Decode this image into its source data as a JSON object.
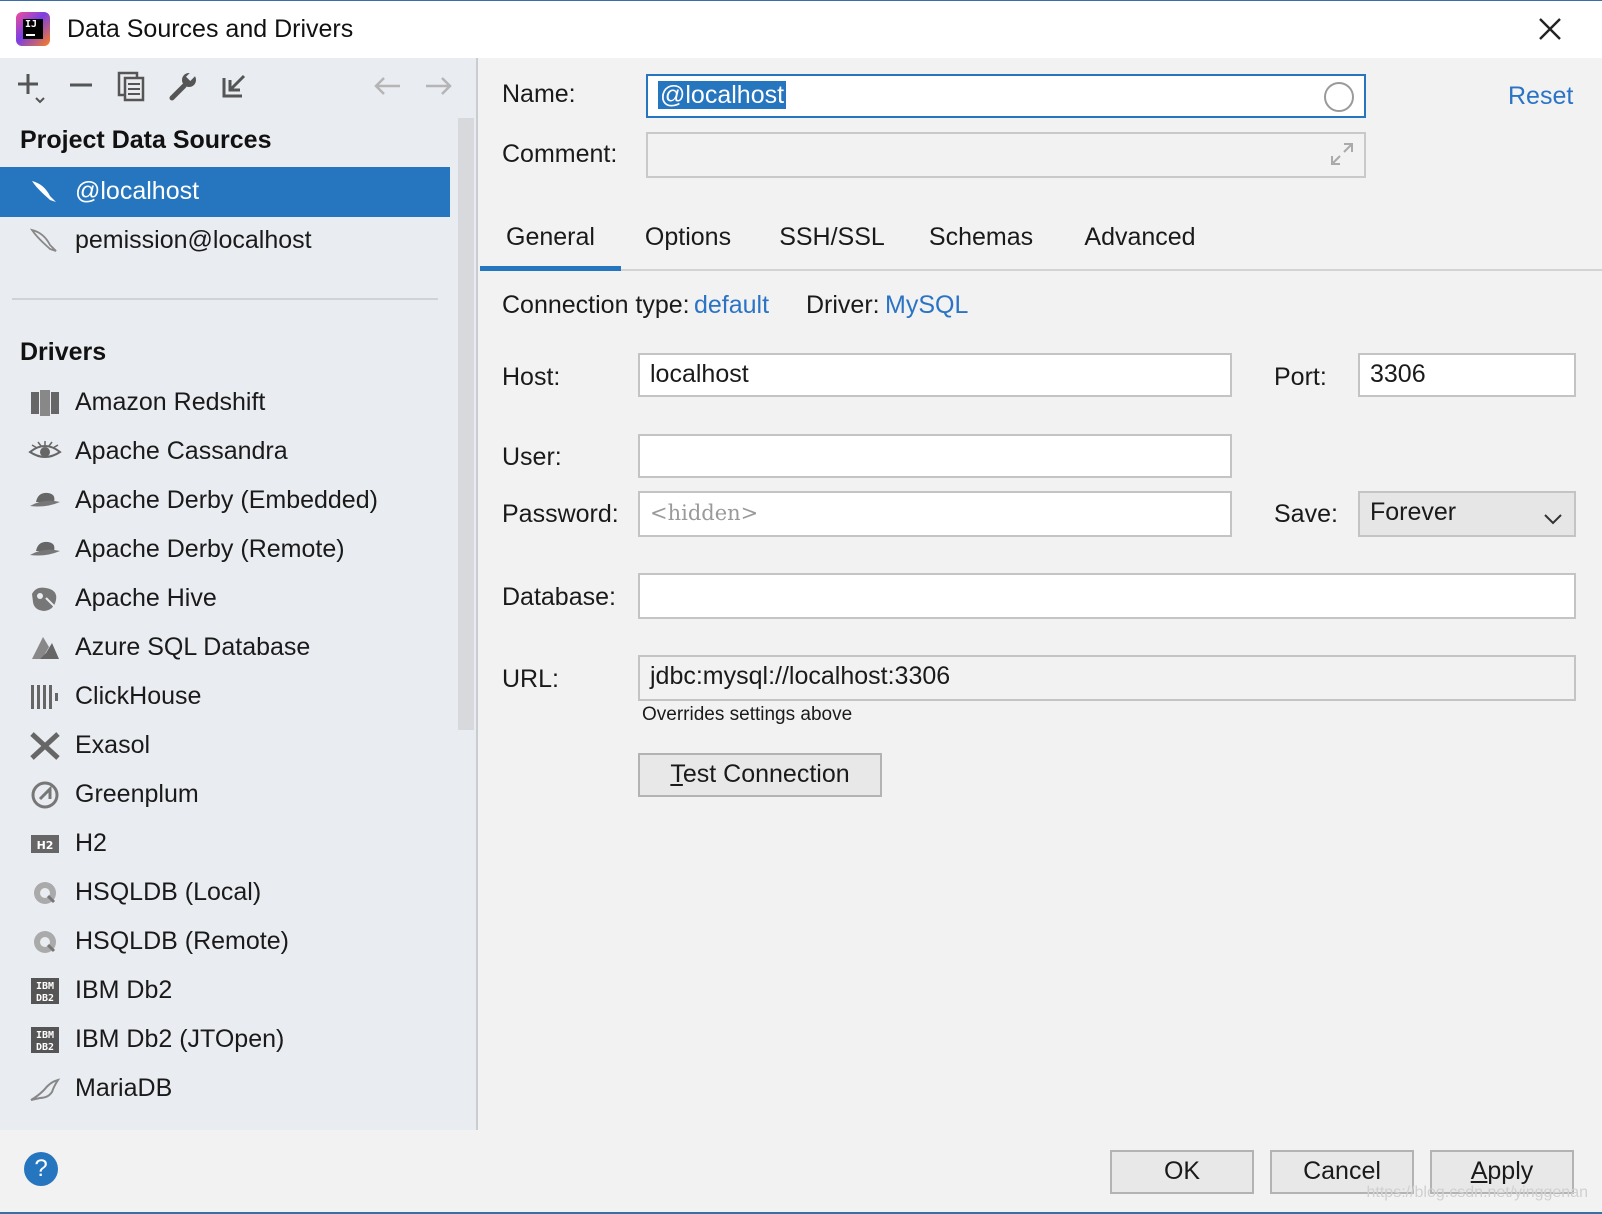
{
  "window": {
    "title": "Data Sources and Drivers",
    "close_icon": "close-icon"
  },
  "left": {
    "toolbar": [
      "add-icon",
      "remove-icon",
      "duplicate-icon",
      "wrench-icon",
      "import-icon",
      "back-arrow-icon",
      "forward-arrow-icon"
    ],
    "project_title": "Project Data Sources",
    "data_sources": [
      {
        "label": "@localhost",
        "icon": "mysql-dolphin-icon",
        "selected": true
      },
      {
        "label": "pemission@localhost",
        "icon": "mysql-dolphin-icon",
        "selected": false
      }
    ],
    "drivers_title": "Drivers",
    "drivers": [
      {
        "label": "Amazon Redshift",
        "icon": "redshift-icon"
      },
      {
        "label": "Apache Cassandra",
        "icon": "cassandra-eye-icon"
      },
      {
        "label": "Apache Derby (Embedded)",
        "icon": "derby-hat-icon"
      },
      {
        "label": "Apache Derby (Remote)",
        "icon": "derby-hat-icon"
      },
      {
        "label": "Apache Hive",
        "icon": "hive-icon"
      },
      {
        "label": "Azure SQL Database",
        "icon": "azure-icon"
      },
      {
        "label": "ClickHouse",
        "icon": "clickhouse-icon"
      },
      {
        "label": "Exasol",
        "icon": "exasol-x-icon"
      },
      {
        "label": "Greenplum",
        "icon": "greenplum-icon"
      },
      {
        "label": "H2",
        "icon": "h2-icon"
      },
      {
        "label": "HSQLDB (Local)",
        "icon": "hsqldb-icon"
      },
      {
        "label": "HSQLDB (Remote)",
        "icon": "hsqldb-icon"
      },
      {
        "label": "IBM Db2",
        "icon": "ibm-db2-icon"
      },
      {
        "label": "IBM Db2 (JTOpen)",
        "icon": "ibm-db2-icon"
      },
      {
        "label": "MariaDB",
        "icon": "mariadb-seal-icon"
      }
    ]
  },
  "right": {
    "name_label": "Name:",
    "name_value": "@localhost",
    "comment_label": "Comment:",
    "comment_value": "",
    "reset_label": "Reset",
    "tabs": [
      "General",
      "Options",
      "SSH/SSL",
      "Schemas",
      "Advanced"
    ],
    "active_tab": "General",
    "connection_type_label": "Connection type:",
    "connection_type_value": "default",
    "driver_label": "Driver:",
    "driver_value": "MySQL",
    "host_label": "Host:",
    "host_value": "localhost",
    "port_label": "Port:",
    "port_value": "3306",
    "user_label": "User:",
    "user_value": "",
    "password_label": "Password:",
    "password_placeholder": "<hidden>",
    "save_label": "Save:",
    "save_value": "Forever",
    "database_label": "Database:",
    "database_value": "",
    "url_label": "URL:",
    "url_value": "jdbc:mysql://localhost:3306",
    "url_hint": "Overrides settings above",
    "test_connection_first": "T",
    "test_connection_rest": "est Connection"
  },
  "footer": {
    "help": "?",
    "ok": "OK",
    "cancel": "Cancel",
    "apply_first": "A",
    "apply_rest": "pply",
    "watermark": "https://blog.csdn.net/yinggenan"
  },
  "colors": {
    "accent": "#2675bf",
    "link": "#2a73c5",
    "left_bg": "#e9ecf0",
    "right_bg": "#f2f2f2"
  }
}
